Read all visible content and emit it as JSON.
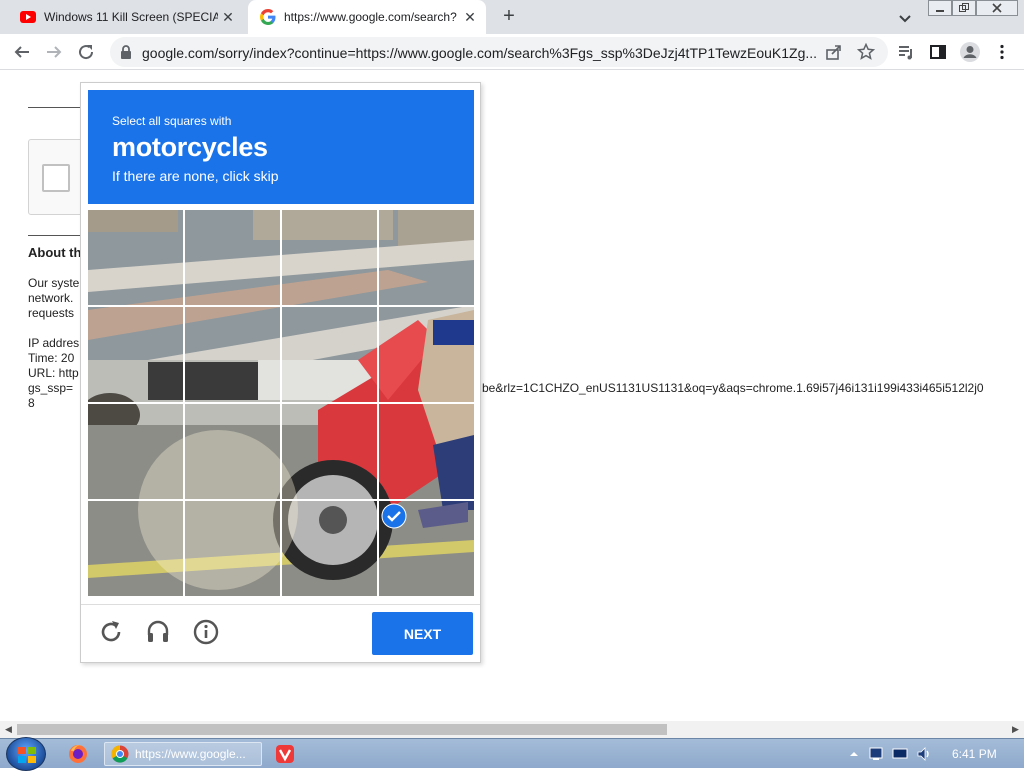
{
  "browser": {
    "tabs": [
      {
        "title": "Windows 11 Kill Screen (SPECIAL",
        "favicon": "youtube-icon",
        "active": false
      },
      {
        "title": "https://www.google.com/search?",
        "favicon": "google-icon",
        "active": true
      }
    ],
    "url": "google.com/sorry/index?continue=https://www.google.com/search%3Fgs_ssp%3DeJzj4tTP1TewzEouK1Zg..."
  },
  "page": {
    "heading_about": "About th",
    "body_lines": [
      "Our syste",
      "network.",
      "requests"
    ],
    "ip_label": "IP addres",
    "time_label": "Time: 20",
    "url_label": "URL: http",
    "gs_ssp_line": "gs_ssp=",
    "url_tail": "be&rlz=1C1CHZO_enUS1131US1131&oq=y&aqs=chrome.1.69i57j46i131i199i433i465i512l2j0",
    "url_end": "8"
  },
  "challenge": {
    "intro": "Select all squares with",
    "target": "motorcycles",
    "hint": "If there are none, click skip",
    "grid_size": 4,
    "selected_cells": [
      [
        3,
        3
      ]
    ],
    "footer_icons": [
      "reload-icon",
      "audio-icon",
      "info-icon"
    ],
    "next_label": "NEXT"
  },
  "taskbar": {
    "chrome_label": "https://www.google...",
    "clock": "6:41 PM"
  },
  "colors": {
    "challenge_blue": "#1a73e8",
    "tab_strip": "#dee1e6",
    "taskbar": "#8ea9cc"
  }
}
